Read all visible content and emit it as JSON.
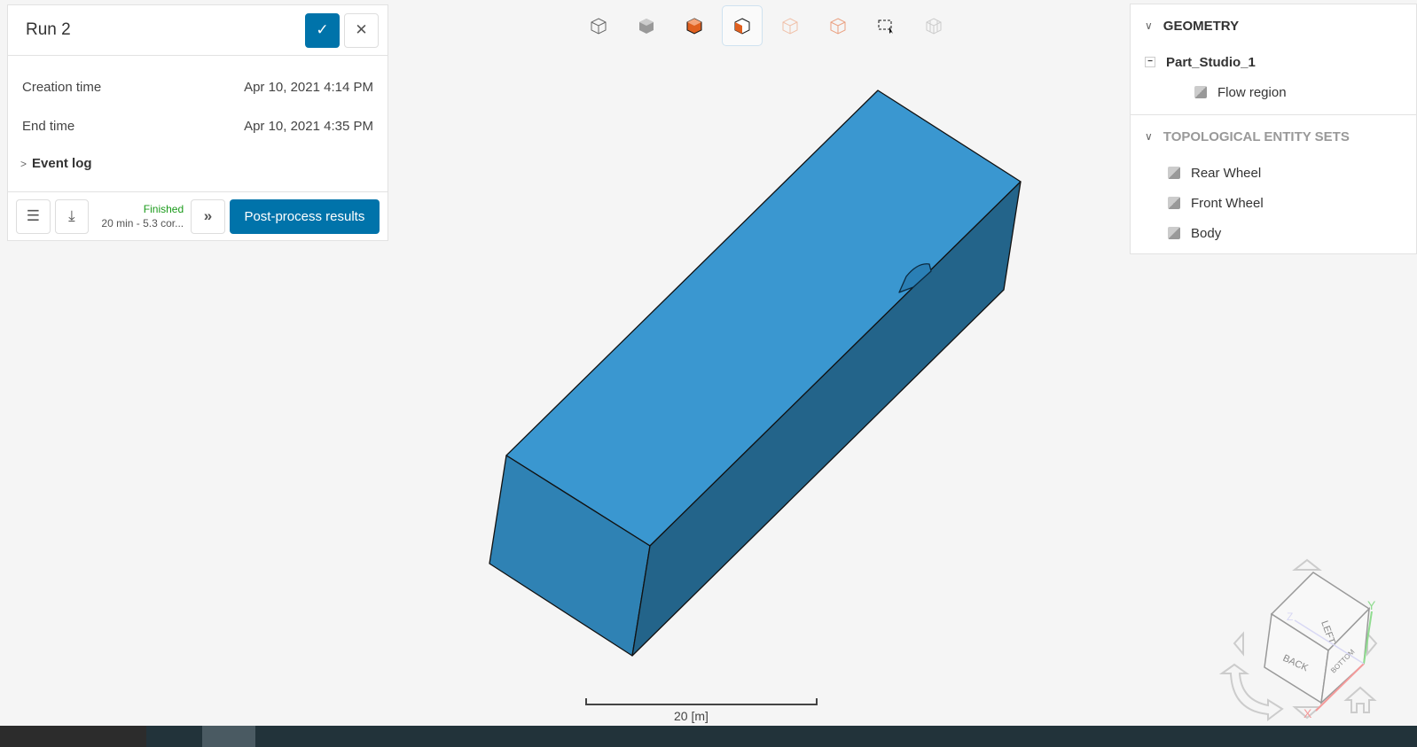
{
  "run_panel": {
    "title": "Run 2",
    "creation_label": "Creation time",
    "creation_value": "Apr 10, 2021 4:14 PM",
    "end_label": "End time",
    "end_value": "Apr 10, 2021 4:35 PM",
    "event_log": "Event log",
    "status": "Finished",
    "status_detail": "20 min - 5.3 cor...",
    "post_process": "Post-process results"
  },
  "tree": {
    "geometry_header": "GEOMETRY",
    "part": "Part_Studio_1",
    "flow_region": "Flow region",
    "sets_header": "TOPOLOGICAL ENTITY SETS",
    "sets": [
      {
        "label": "Rear Wheel"
      },
      {
        "label": "Front Wheel"
      },
      {
        "label": "Body"
      }
    ]
  },
  "view_cube": {
    "faces": [
      "LEFT",
      "BACK",
      "BOTTOM"
    ],
    "axes": [
      "X",
      "Y",
      "Z"
    ]
  },
  "scale_bar": {
    "label": "20 [m]"
  },
  "colors": {
    "primary": "#0073aa",
    "model_top": "#3a97d0",
    "model_front": "#2f82b4",
    "model_side": "#23648a",
    "finished": "#1a9a1a"
  }
}
